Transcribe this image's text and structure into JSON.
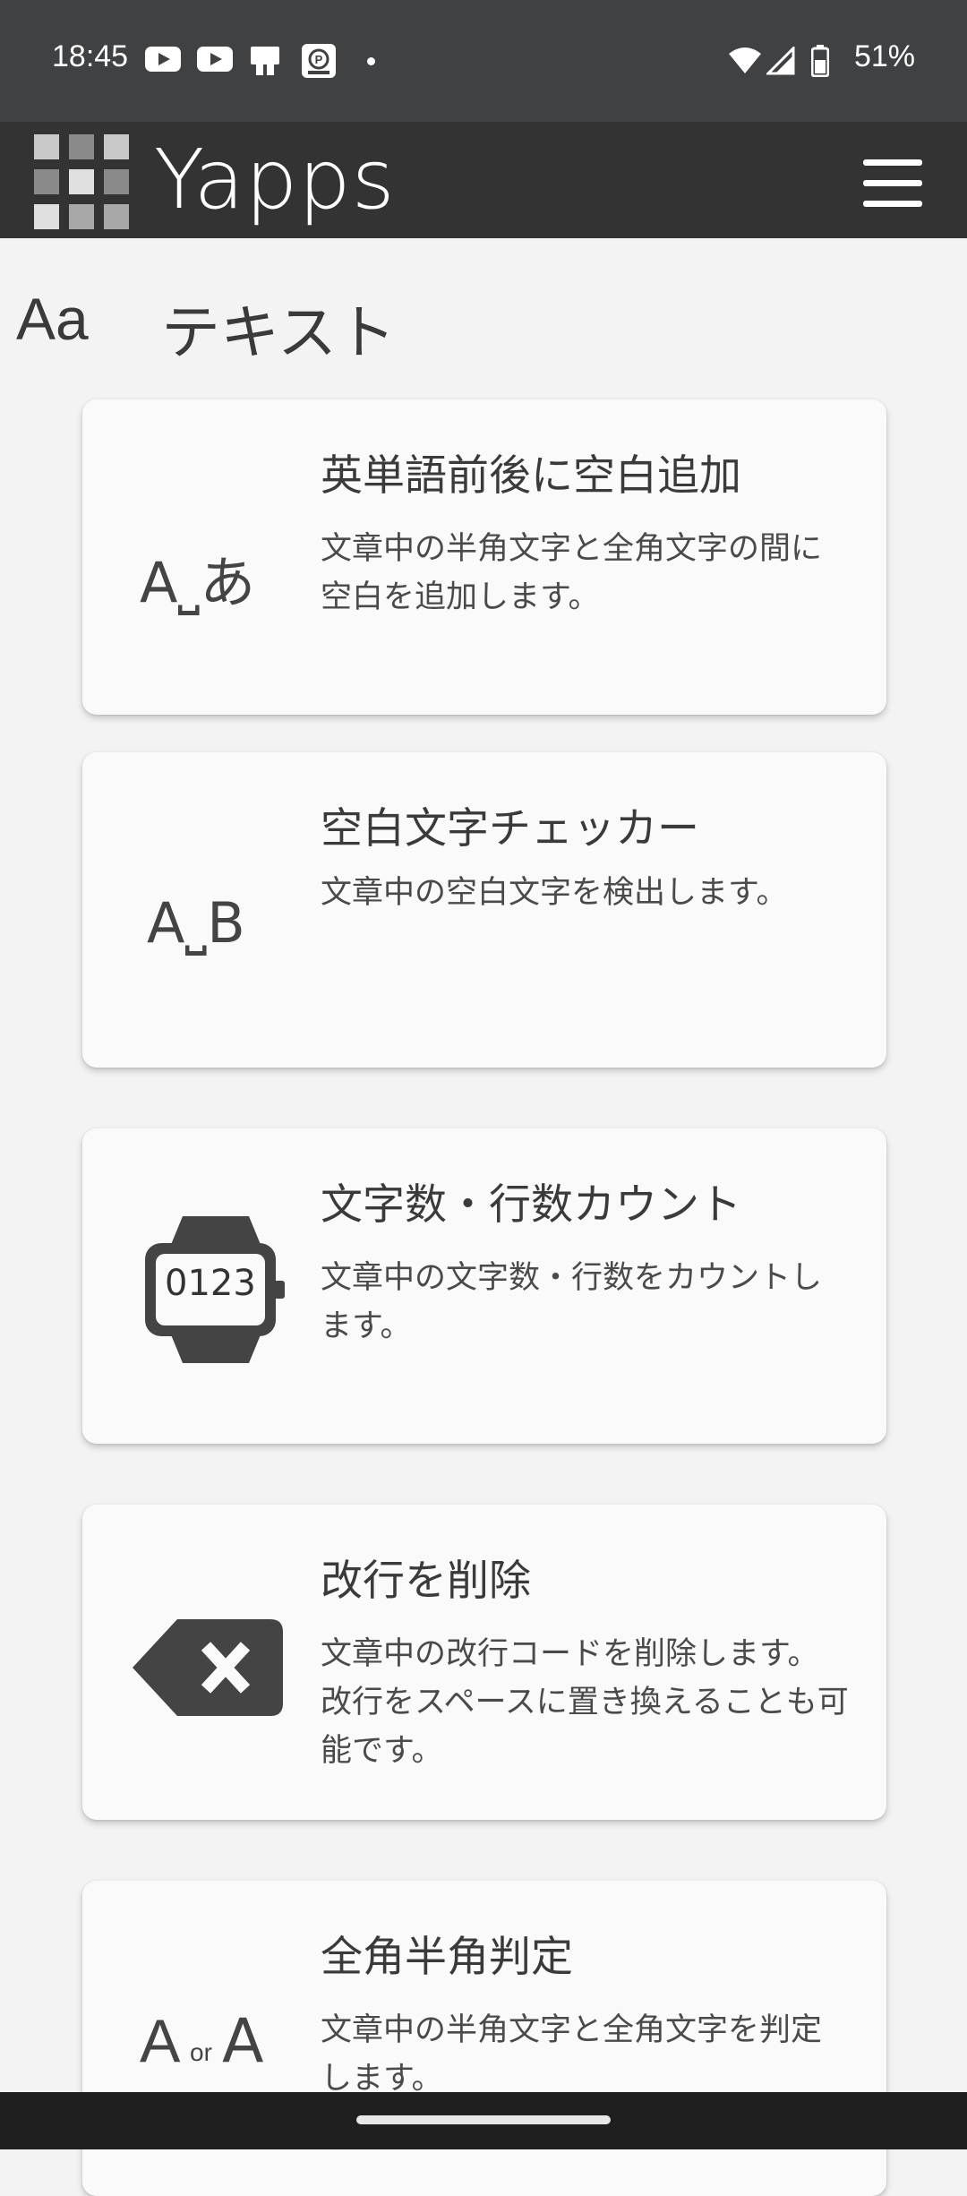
{
  "status_bar": {
    "time": "18:45",
    "battery": "51%",
    "icons": [
      "youtube-icon",
      "youtube-icon",
      "cast-icon",
      "parking-app-icon",
      "notification-dot",
      "wifi-icon",
      "signal-icon",
      "battery-icon"
    ]
  },
  "app_bar": {
    "title": "Yapps",
    "menu_icon": "hamburger-menu-icon"
  },
  "section": {
    "icon_text": "Aa",
    "title": "テキスト"
  },
  "cards": [
    {
      "icon_text": "A⎵あ",
      "title": "英単語前後に空白追加",
      "description": "文章中の半角文字と全角文字の間に空白を追加します。"
    },
    {
      "icon_text": "A⎵B",
      "title": "空白文字チェッカー",
      "description": "文章中の空白文字を検出します。"
    },
    {
      "icon_text": "0123",
      "title": "文字数・行数カウント",
      "description": "文章中の文字数・行数をカウントします。"
    },
    {
      "icon_text": "",
      "title": "改行を削除",
      "description": "文章中の改行コードを削除します。改行をスペースに置き換えることも可能です。"
    },
    {
      "icon_text": "A",
      "icon_text_or": "or",
      "icon_text_b": "A",
      "title": "全角半角判定",
      "description": "文章中の半角文字と全角文字を判定します。"
    }
  ],
  "colors": {
    "status_bar": "#3f4143",
    "app_bar": "#333333",
    "background": "#f3f3f3",
    "card": "#fafafa"
  }
}
